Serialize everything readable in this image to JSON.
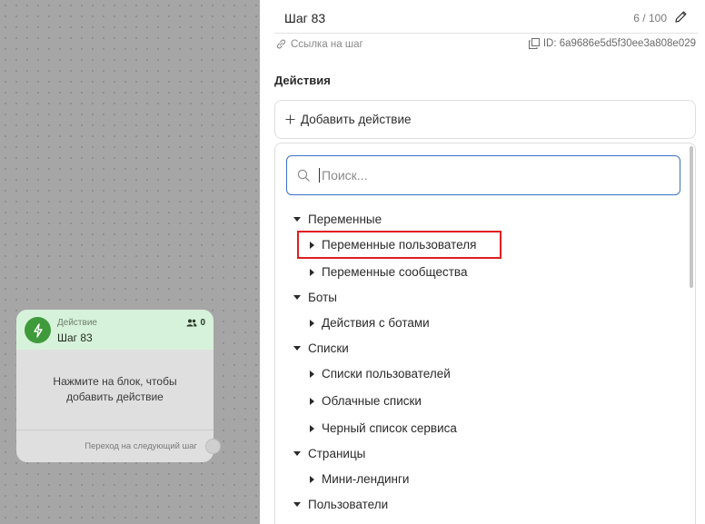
{
  "node": {
    "type_label": "Действие",
    "title": "Шаг 83",
    "users_count": "0",
    "body_text": "Нажмите на блок, чтобы добавить действие",
    "footer_text": "Переход на следующий шаг",
    "icon": "lightning-icon",
    "accent": "#3f9a3c"
  },
  "panel": {
    "step_title": "Шаг 83",
    "char_count": "6 / 100",
    "link_label": "Ссылка на шаг",
    "id_label": "ID: 6a9686e5d5f30ee3a808e029",
    "section_title": "Действия",
    "add_action_label": "Добавить действие"
  },
  "dropdown": {
    "search_placeholder": "Поиск...",
    "items": [
      {
        "label": "Переменные",
        "level": 0,
        "expanded": true
      },
      {
        "label": "Переменные пользователя",
        "level": 1,
        "expanded": false,
        "highlighted": true
      },
      {
        "label": "Переменные сообщества",
        "level": 1,
        "expanded": false
      },
      {
        "label": "Боты",
        "level": 0,
        "expanded": true
      },
      {
        "label": "Действия с ботами",
        "level": 1,
        "expanded": false
      },
      {
        "label": "Списки",
        "level": 0,
        "expanded": true
      },
      {
        "label": "Списки пользователей",
        "level": 1,
        "expanded": false
      },
      {
        "label": "Облачные списки",
        "level": 1,
        "expanded": false
      },
      {
        "label": "Черный список сервиса",
        "level": 1,
        "expanded": false
      },
      {
        "label": "Страницы",
        "level": 0,
        "expanded": true
      },
      {
        "label": "Мини-лендинги",
        "level": 1,
        "expanded": false
      },
      {
        "label": "Пользователи",
        "level": 0,
        "expanded": true
      }
    ]
  },
  "colors": {
    "highlight_border": "#e01e1e",
    "search_border": "#3b72c6"
  }
}
